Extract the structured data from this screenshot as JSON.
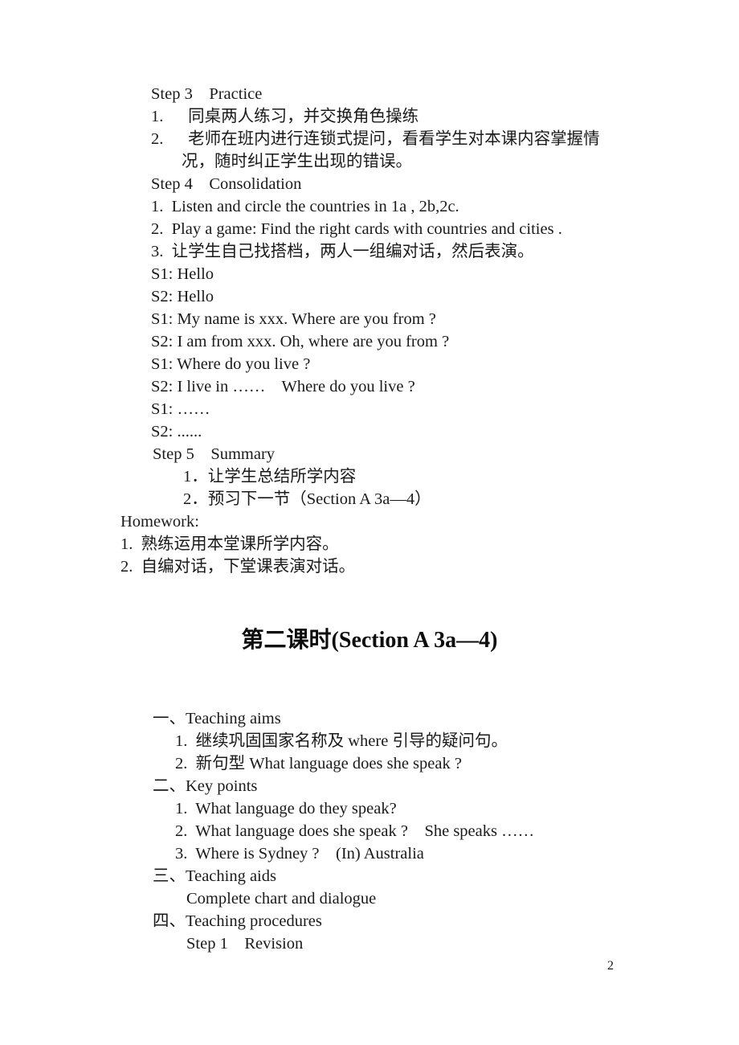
{
  "document": {
    "page_number": "2",
    "heading": "第二课时(Section A 3a—4)"
  },
  "section_top": {
    "lines": [
      "Step 3    Practice",
      "1.      同桌两人练习，并交换角色操练",
      "2.      老师在班内进行连锁式提问，看看学生对本课内容掌握情",
      "况，随时纠正学生出现的错误。",
      "Step 4    Consolidation",
      "1.  Listen and circle the countries in 1a , 2b,2c.",
      "2.  Play a game: Find the right cards with countries and cities .",
      "3.  让学生自己找搭档，两人一组编对话，然后表演。",
      "S1: Hello",
      "S2: Hello",
      "S1: My name is xxx. Where are you from ?",
      "S2: I am from xxx. Oh, where are you from ?",
      "S1: Where do you live ?",
      "S2: I live in ……    Where do you live ?",
      "S1: ……",
      "S2: ......",
      "Step 5    Summary",
      "1．让学生总结所学内容",
      "2．预习下一节（Section A 3a—4）",
      "Homework:",
      "1.  熟练运用本堂课所学内容。",
      "2.  自编对话，下堂课表演对话。"
    ]
  },
  "section_bottom": {
    "lines": [
      "一、Teaching aims",
      "1.  继续巩固国家名称及 where 引导的疑问句。",
      "2.  新句型 What language does she speak ?",
      "二、Key points",
      "1.  What language do they speak?",
      "2.  What language does she speak ?    She speaks ……",
      "3.  Where is Sydney ?    (In) Australia",
      "三、Teaching aids",
      "Complete chart and dialogue",
      "四、Teaching procedures",
      "Step 1    Revision"
    ]
  }
}
